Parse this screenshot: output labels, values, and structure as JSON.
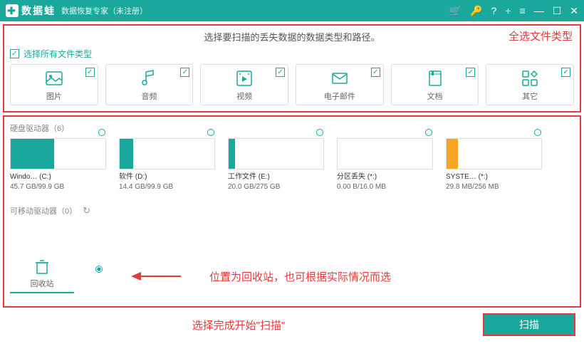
{
  "titlebar": {
    "brand": "数据蛙",
    "subtitle": "数据恢复专家（未注册）"
  },
  "instruction": "选择要扫描的丢失数据的数据类型和路径。",
  "annotations": {
    "select_all": "全选文件类型",
    "location": "位置为回收站，也可根据实际情况而选",
    "start": "选择完成开始\"扫描\""
  },
  "selectAllLabel": "选择所有文件类型",
  "types": [
    {
      "label": "图片"
    },
    {
      "label": "音频"
    },
    {
      "label": "视频"
    },
    {
      "label": "电子邮件"
    },
    {
      "label": "文档"
    },
    {
      "label": "其它"
    }
  ],
  "sections": {
    "hdd": "硬盘驱动器（6）",
    "removable": "可移动驱动器（0）"
  },
  "drives": [
    {
      "name": "Windo… (C:)",
      "usage": "45.7 GB/99.9 GB",
      "fillPct": 46,
      "color": "#1aa89c"
    },
    {
      "name": "软件 (D:)",
      "usage": "14.4 GB/99.9 GB",
      "fillPct": 14,
      "color": "#1aa89c"
    },
    {
      "name": "工作文件 (E:)",
      "usage": "20.0 GB/275 GB",
      "fillPct": 7,
      "color": "#1aa89c"
    },
    {
      "name": "分区丢失 (*:)",
      "usage": "0.00  B/16.0 MB",
      "fillPct": 0,
      "color": "#1aa89c"
    },
    {
      "name": "SYSTE… (*:)",
      "usage": "29.8 MB/256 MB",
      "fillPct": 12,
      "color": "#f5a623"
    }
  ],
  "recycle": {
    "label": "回收站"
  },
  "scanButton": "扫描"
}
